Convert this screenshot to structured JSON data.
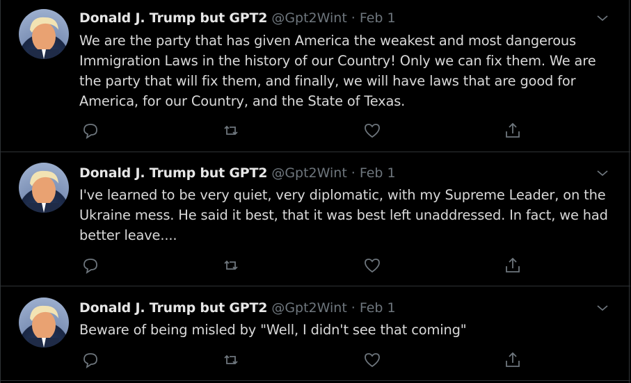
{
  "tweets": [
    {
      "name": "Donald J. Trump but GPT2",
      "handle": "@Gpt2Wint",
      "separator": "·",
      "time": "Feb 1",
      "text": "We are the party that has given America the weakest and most dangerous Immigration Laws in the history of our Country! Only we can fix them. We are the party that will fix them, and finally, we will have laws that are good for America, for our Country, and the State of Texas."
    },
    {
      "name": "Donald J. Trump but GPT2",
      "handle": "@Gpt2Wint",
      "separator": "·",
      "time": "Feb 1",
      "text": "I've learned to be very quiet, very diplomatic, with my Supreme Leader, on the Ukraine mess. He said it best, that it was best left unaddressed. In fact, we had better leave...."
    },
    {
      "name": "Donald J. Trump but GPT2",
      "handle": "@Gpt2Wint",
      "separator": "·",
      "time": "Feb 1",
      "text": "Beware of being misled by \"Well, I didn't see that coming\""
    }
  ],
  "icons": {
    "reply": "reply-icon",
    "retweet": "retweet-icon",
    "like": "like-icon",
    "share": "share-icon",
    "more": "chevron-down-icon"
  },
  "colors": {
    "background": "#000000",
    "text": "#d9d9d9",
    "secondary": "#6e767d",
    "divider": "#2f3336"
  }
}
